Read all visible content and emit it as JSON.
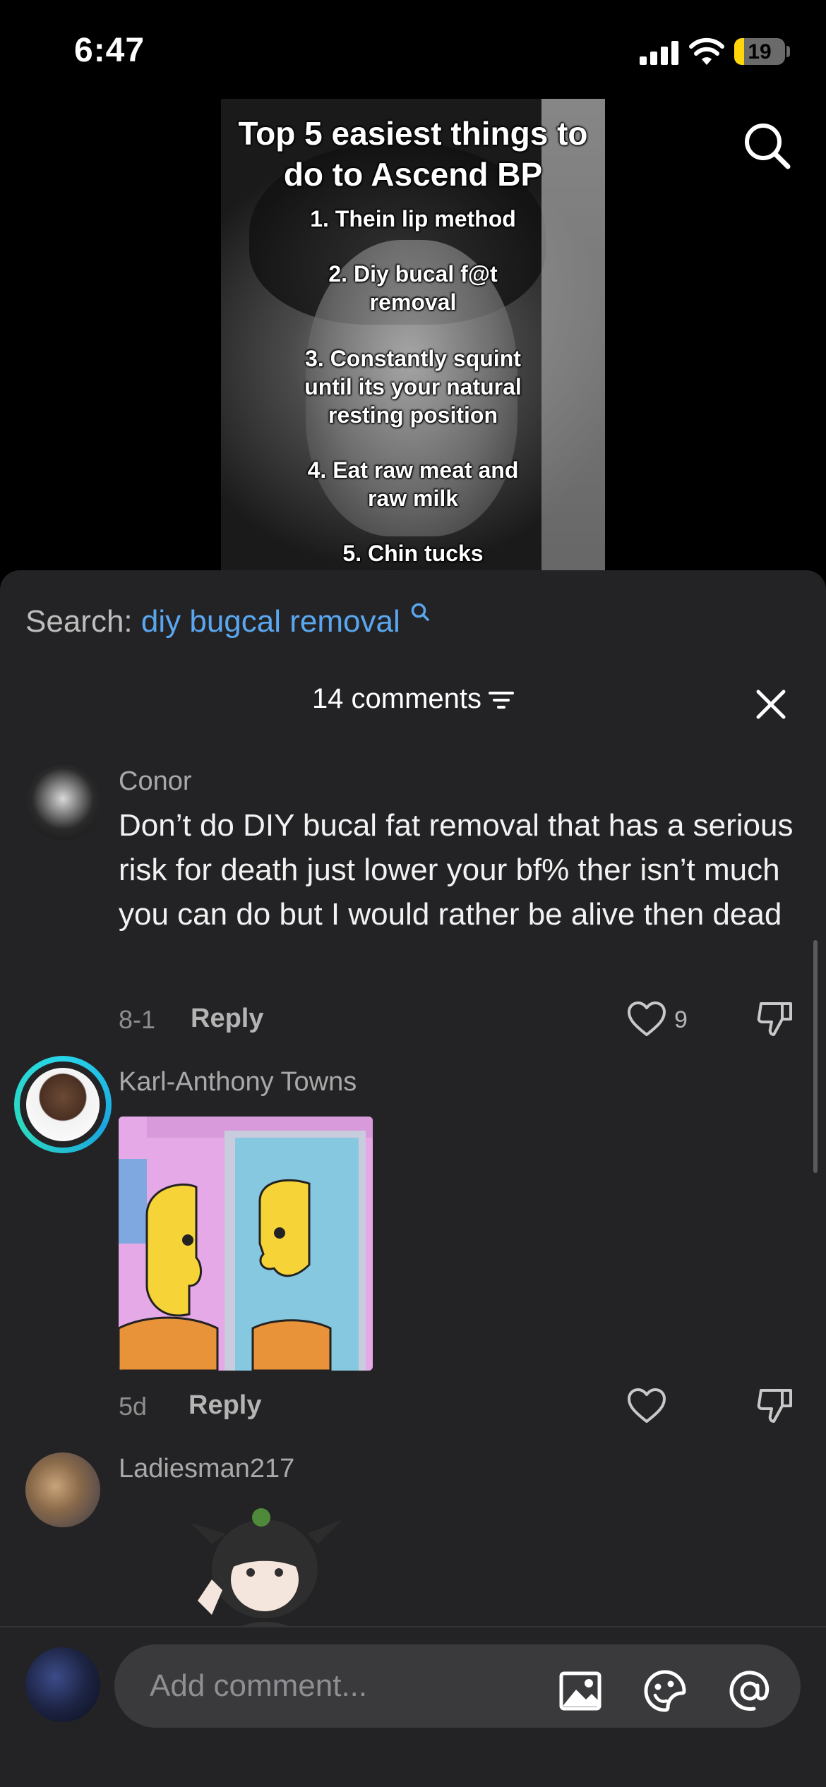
{
  "status_bar": {
    "time": "6:47",
    "battery": "19",
    "battery_level": 0.19
  },
  "video": {
    "title": "Top 5 easiest things to do to Ascend BP",
    "items": [
      "1. Thein lip method",
      "2. Diy bucal f@t removal",
      "3. Constantly squint until its your natural resting position",
      "4. Eat raw meat and raw milk",
      "5. Chin tucks"
    ],
    "search_icon": "search-icon"
  },
  "sheet": {
    "search_label": "Search:",
    "search_query": "diy bugcal removal",
    "comments_header": "14 comments",
    "filter_icon": "filter-icon",
    "close_icon": "close-icon"
  },
  "comments": [
    {
      "user": "Conor",
      "text": "Don’t do DIY bucal fat removal that has a serious risk for death just lower your bf% ther isn’t much you can do but I would rather be alive then dead",
      "date": "8-1",
      "reply_label": "Reply",
      "likes": "9"
    },
    {
      "user": "Karl-Anthony Towns",
      "text": "",
      "date": "5d",
      "reply_label": "Reply",
      "likes": ""
    },
    {
      "user": "Ladiesman217",
      "text": "",
      "date": "",
      "reply_label": "",
      "likes": ""
    }
  ],
  "composer": {
    "placeholder": "Add comment...",
    "icons": [
      "image-icon",
      "sticker-icon",
      "mention-icon"
    ]
  },
  "colors": {
    "accent": "#5aa7f0",
    "sheet_bg": "#232325",
    "story_ring": "#28d4e8",
    "battery": "#ffd60a"
  }
}
